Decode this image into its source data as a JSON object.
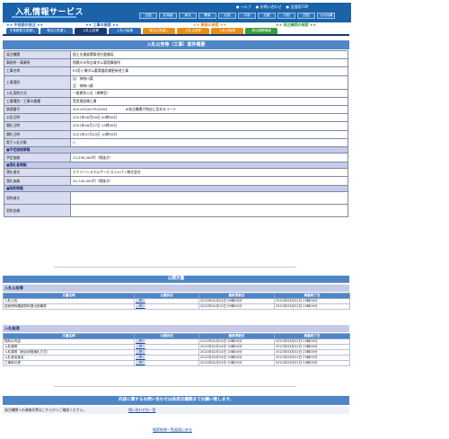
{
  "header": {
    "title": "入札情報サービス",
    "top_links": [
      "● ヘルプ",
      "● お問い合わせ",
      "● 全国版TOP"
    ],
    "regions": [
      "全国",
      "北海道",
      "東北",
      "関東",
      "北陸",
      "中部",
      "近畿",
      "中国",
      "四国",
      "九州沖縄"
    ]
  },
  "categories": {
    "left": "★★ 中長期の発注 ★★",
    "work": "★★ 工事の検索 ★★",
    "service": "★★ 業務の検索 ★★",
    "orderer": "★★ 発注機関の検索 ★★"
  },
  "tabs": [
    {
      "label": "中長期発注見通し",
      "color": "#2c6cb4"
    },
    {
      "label": "発注の見通し",
      "color": "#2c6cb4"
    },
    {
      "label": "入札公告等",
      "color": "#1b3a6e"
    },
    {
      "label": "入札の結果",
      "color": "#2c6cb4"
    },
    {
      "label": "発注の見通し",
      "color": "#e48f1a"
    },
    {
      "label": "入札公告等",
      "color": "#e48f1a"
    },
    {
      "label": "入札の結果",
      "color": "#e48f1a"
    },
    {
      "label": "発注機関情報",
      "color": "#3c9a3c"
    }
  ],
  "page_title": "入札公告等（工事）案件概要",
  "detail": {
    "rows": [
      {
        "key": "発注機関",
        "value": "国土交通省関東地方整備局"
      },
      {
        "key": "事務所・事業所",
        "value": "相模川水系広域ダム管理事務所"
      },
      {
        "key": "工事名称",
        "value": "R3宮ヶ瀬ダム蓄電器設備更新他工事"
      },
      {
        "key": "工事場所",
        "value": "自：神奈川県",
        "value2": "至：神奈川県"
      },
      {
        "key": "入札契約方式",
        "value": "一般競争入札（標準型）"
      },
      {
        "key": "工事種別／工事の業種",
        "value": "受変電設備工事"
      },
      {
        "key": "調達番号",
        "value": "2021032007910004",
        "note": "★発注機関が独自に定めるコード"
      },
      {
        "key": "公告日時",
        "value": "2021年06月09日 00時00分"
      },
      {
        "key": "開札日時",
        "value": "2021年06月17日 15時00分"
      },
      {
        "key": "開札日時",
        "value": "2021年07月20日 10時00分"
      },
      {
        "key": "電子入札対象",
        "value": "○"
      }
    ],
    "section_planned": "■予定価格情報",
    "planned_price_key": "予定価格",
    "planned_price": "23,290,000円（税抜き）",
    "section_winner": "■落札者情報",
    "winner_key": "落札者名",
    "winner": "エナジーシステムサービスジャパン株式会社",
    "winning_price_key": "落札価格",
    "winning_price": "20,700,000円（税抜き）",
    "section_contract": "■契約情報",
    "contract_name_key": "契約者名",
    "contract_amount_key": "契約金額"
  },
  "documents": {
    "title": "公開文書",
    "bid_notice_group": "入札公告等",
    "columns": [
      "文書名称",
      "公開状況",
      "最終更新日",
      "掲載終了日"
    ],
    "bid_notice_rows": [
      [
        "入札公告",
        "公開中",
        "2021年02月24日 09時00分",
        "2021年03月31日 23時00分"
      ],
      [
        "技術資料確認資料提出依頼書",
        "公開中",
        "2021年02月15日 09時00分",
        "2021年03月31日 23時00分"
      ]
    ],
    "bid_result_group": "入札経過",
    "bid_result_rows": [
      [
        "契約の内容",
        "公開中",
        "2021年02月24日 10時00分",
        "2021年03月31日 23時00分"
      ],
      [
        "入札調書",
        "公開中",
        "2021年02月24日 10時00分",
        "2021年03月31日 23時00分"
      ],
      [
        "入札調書（総合評価落札方式）",
        "公開中",
        "2021年02月14日 10時00分",
        "2021年03月31日 23時00分"
      ],
      [
        "入札参加者名",
        "公開中",
        "2021年02月14日 10時00分",
        "2021年03月31日 23時00分"
      ],
      [
        "工事設計書",
        "公開中",
        "2021年02月24日 10時00分",
        "2021年03月31日 23時00分"
      ]
    ]
  },
  "notice": "内容に関するお問い合わせは各発注機関までお願い致します。",
  "inquiry": {
    "text": "発注機関への連絡先等はこちらからご確認ください。",
    "link": "問い合わせ先一覧"
  },
  "back_link": "検索結果一覧画面に戻る"
}
